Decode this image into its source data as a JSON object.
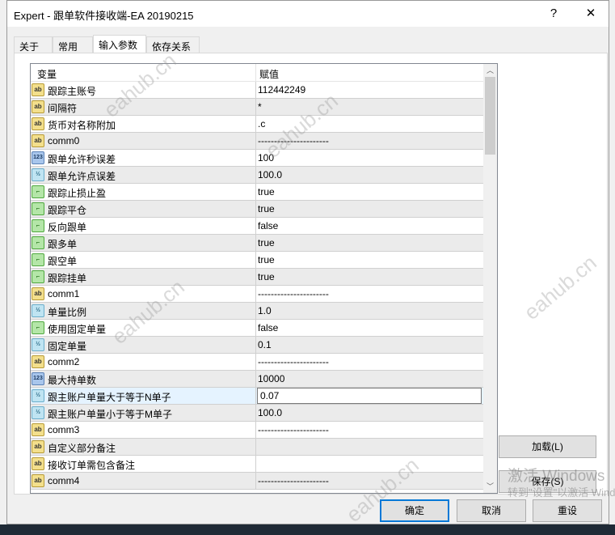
{
  "window": {
    "title": "Expert - 跟单软件接收端-EA   20190215",
    "help": "?",
    "close": "✕"
  },
  "tabs": [
    "关于",
    "常用",
    "输入参数",
    "依存关系"
  ],
  "grid": {
    "col_variable": "变量",
    "col_value": "赋值",
    "rows": [
      {
        "type": "ab",
        "name": "跟踪主账号",
        "value": "112442249"
      },
      {
        "type": "ab",
        "name": "间隔符",
        "value": "*"
      },
      {
        "type": "ab",
        "name": "货币对名称附加",
        "value": ".c"
      },
      {
        "type": "ab",
        "name": "comm0",
        "value": "----------------------"
      },
      {
        "type": "123",
        "name": "跟单允许秒误差",
        "value": "100"
      },
      {
        "type": "half",
        "name": "跟单允许点误差",
        "value": "100.0"
      },
      {
        "type": "bool",
        "name": "跟踪止损止盈",
        "value": "true"
      },
      {
        "type": "bool",
        "name": "跟踪平仓",
        "value": "true"
      },
      {
        "type": "bool",
        "name": "反向跟单",
        "value": "false"
      },
      {
        "type": "bool",
        "name": "跟多单",
        "value": "true"
      },
      {
        "type": "bool",
        "name": "跟空单",
        "value": "true"
      },
      {
        "type": "bool",
        "name": "跟踪挂单",
        "value": "true"
      },
      {
        "type": "ab",
        "name": "comm1",
        "value": "----------------------"
      },
      {
        "type": "half",
        "name": "单量比例",
        "value": "1.0"
      },
      {
        "type": "bool",
        "name": "使用固定单量",
        "value": "false"
      },
      {
        "type": "half",
        "name": "固定单量",
        "value": "0.1"
      },
      {
        "type": "ab",
        "name": "comm2",
        "value": "----------------------"
      },
      {
        "type": "123",
        "name": "最大持单数",
        "value": "10000"
      },
      {
        "type": "half",
        "name": "跟主账户单量大于等于N单子",
        "value": "0.07",
        "selected": true
      },
      {
        "type": "half",
        "name": "跟主账户单量小于等于M单子",
        "value": "100.0"
      },
      {
        "type": "ab",
        "name": "comm3",
        "value": "----------------------"
      },
      {
        "type": "ab",
        "name": "自定义部分备注",
        "value": ""
      },
      {
        "type": "ab",
        "name": "接收订单需包含备注",
        "value": ""
      },
      {
        "type": "ab",
        "name": "comm4",
        "value": "----------------------"
      }
    ]
  },
  "buttons": {
    "load": "加载(L)",
    "save": "保存(S)",
    "ok": "确定",
    "cancel": "取消",
    "reset": "重设"
  },
  "watermark": "eahub.cn",
  "activation": {
    "line1": "激活 Windows",
    "line2": "转到\"设置\"以激活 Windows。"
  }
}
